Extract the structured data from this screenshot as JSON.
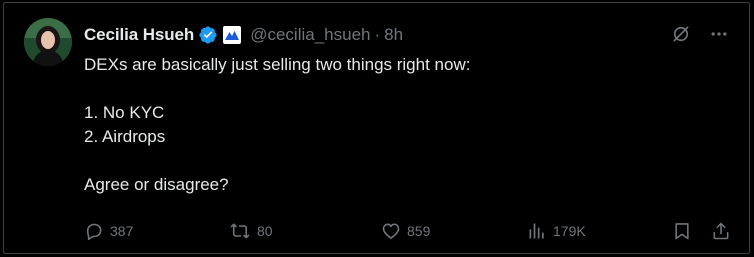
{
  "author": {
    "name": "Cecilia Hsueh",
    "handle": "@cecilia_hsueh",
    "separator": "·",
    "time": "8h",
    "verified": true
  },
  "tweet": {
    "lines": [
      "DEXs are basically just selling two things right now:",
      "",
      "1. No KYC",
      "2. Airdrops",
      "",
      "Agree or disagree?"
    ]
  },
  "actions": {
    "replies": "387",
    "reposts": "80",
    "likes": "859",
    "views": "179K"
  },
  "colors": {
    "background": "#000000",
    "text": "#e7e9ea",
    "muted": "#71767b",
    "verified": "#1d9bf0",
    "border": "#3e4144"
  },
  "icons": [
    "grok-icon",
    "more-icon",
    "reply-icon",
    "repost-icon",
    "like-icon",
    "views-icon",
    "bookmark-icon",
    "share-icon"
  ]
}
